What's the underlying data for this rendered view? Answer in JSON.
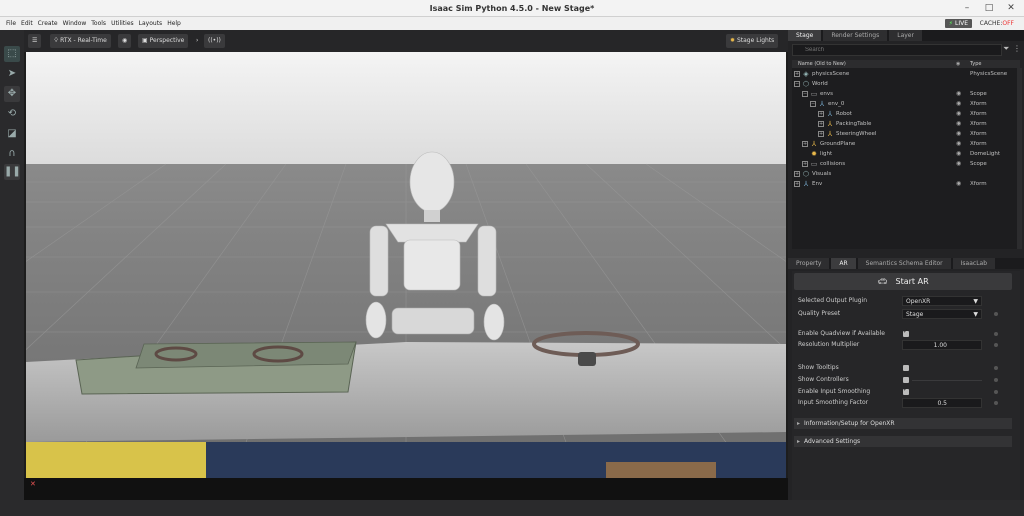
{
  "window": {
    "title": "Isaac Sim Python 4.5.0 - New Stage*"
  },
  "menu": {
    "items": [
      "File",
      "Edit",
      "Create",
      "Window",
      "Tools",
      "Utilities",
      "Layouts",
      "Help"
    ],
    "live_label": "LIVE",
    "cache_prefix": "CACHE:",
    "cache_status": "OFF"
  },
  "viewport": {
    "render_mode": "RTX - Real-Time",
    "camera": "Perspective",
    "stage_lights": "Stage Lights"
  },
  "stage": {
    "tabs": [
      "Stage",
      "Render Settings",
      "Layer"
    ],
    "active_tab": 0,
    "search_placeholder": "Search",
    "col_name": "Name (Old to New)",
    "col_type": "Type",
    "rows": [
      {
        "label": "physicsScene",
        "type": "PhysicsScene",
        "depth": 0,
        "icon": "physics-icon"
      },
      {
        "label": "World",
        "type": "",
        "depth": 0,
        "icon": "cube-icon"
      },
      {
        "label": "envs",
        "type": "Scope",
        "depth": 1,
        "icon": "folder-icon"
      },
      {
        "label": "env_0",
        "type": "Xform",
        "depth": 2,
        "icon": "xform-icon"
      },
      {
        "label": "Robot",
        "type": "Xform",
        "depth": 3,
        "icon": "xform-icon"
      },
      {
        "label": "PackingTable",
        "type": "Xform",
        "depth": 3,
        "icon": "xform-icon"
      },
      {
        "label": "SteeringWheel",
        "type": "Xform",
        "depth": 3,
        "icon": "xform-icon"
      },
      {
        "label": "GroundPlane",
        "type": "Xform",
        "depth": 1,
        "icon": "xform-icon"
      },
      {
        "label": "light",
        "type": "DomeLight",
        "depth": 1,
        "icon": "light-icon"
      },
      {
        "label": "collisions",
        "type": "Scope",
        "depth": 1,
        "icon": "folder-icon"
      },
      {
        "label": "Visuals",
        "type": "",
        "depth": 0,
        "icon": "cube-icon"
      },
      {
        "label": "Env",
        "type": "Xform",
        "depth": 0,
        "icon": "xform-icon"
      }
    ]
  },
  "props": {
    "tabs": [
      "Property",
      "AR",
      "Semantics Schema Editor",
      "IsaacLab"
    ],
    "active_tab": 1,
    "start_ar": "Start AR",
    "output_plugin_label": "Selected Output Plugin",
    "output_plugin_value": "OpenXR",
    "quality_label": "Quality Preset",
    "quality_value": "Stage",
    "quadview_label": "Enable Quadview if Available",
    "quadview_checked": true,
    "resolution_label": "Resolution Multiplier",
    "resolution_value": "1.00",
    "tooltips_label": "Show Tooltips",
    "tooltips_checked": false,
    "controllers_label": "Show Controllers",
    "controllers_checked": false,
    "smoothing_label": "Enable Input Smoothing",
    "smoothing_checked": true,
    "smoothing_factor_label": "Input Smoothing Factor",
    "smoothing_factor_value": "0.5",
    "section_info": "Information/Setup for OpenXR",
    "section_advanced": "Advanced Settings"
  },
  "colors": {
    "accent": "#e8b84a",
    "panel_bg": "#232325",
    "sky": "#f2f2f2",
    "floor": "#7c7c7c"
  }
}
